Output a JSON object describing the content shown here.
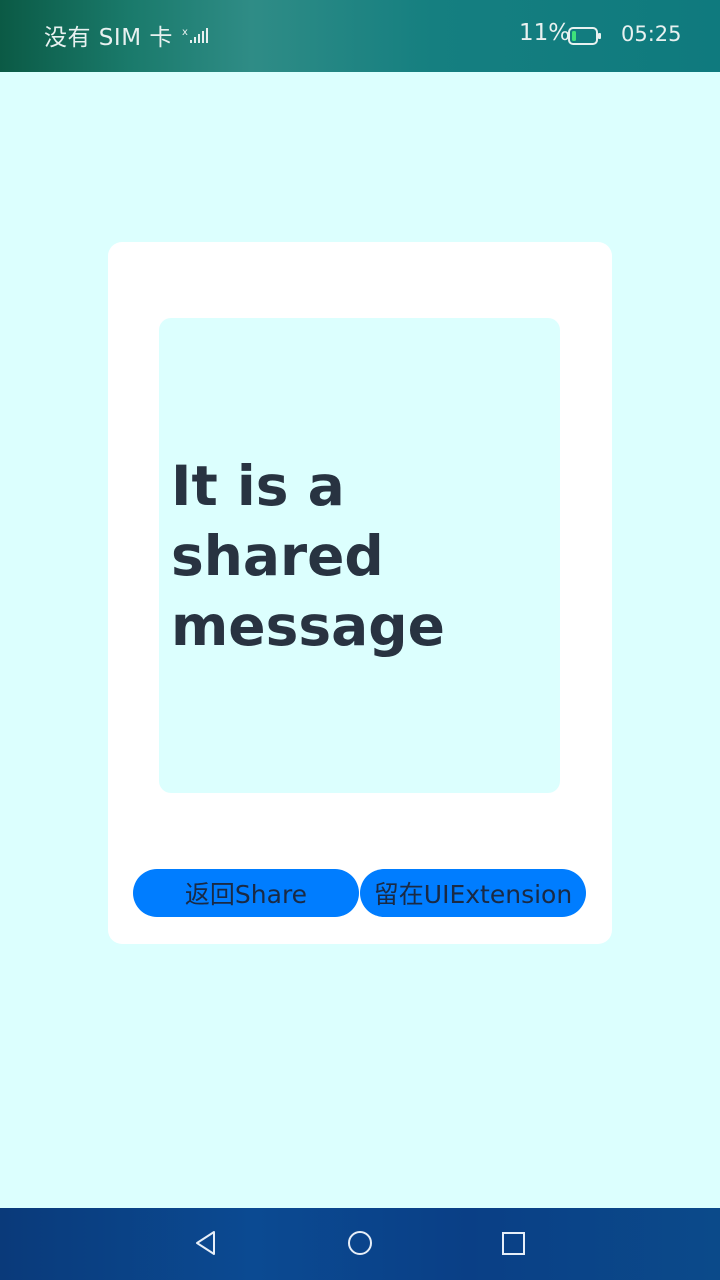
{
  "status_bar": {
    "carrier": "没有 SIM 卡",
    "battery_percent": "11%",
    "time": "05:25"
  },
  "message": {
    "text": "It is a shared message"
  },
  "buttons": {
    "back_label": "返回Share",
    "stay_label": "留在UIExtension"
  },
  "colors": {
    "page_background": "#dcfffe",
    "card_background": "#ffffff",
    "button_background": "#007dff",
    "message_text": "#283341"
  },
  "nav_bar": {
    "icons": [
      "back-triangle-icon",
      "home-circle-icon",
      "recent-square-icon"
    ]
  }
}
